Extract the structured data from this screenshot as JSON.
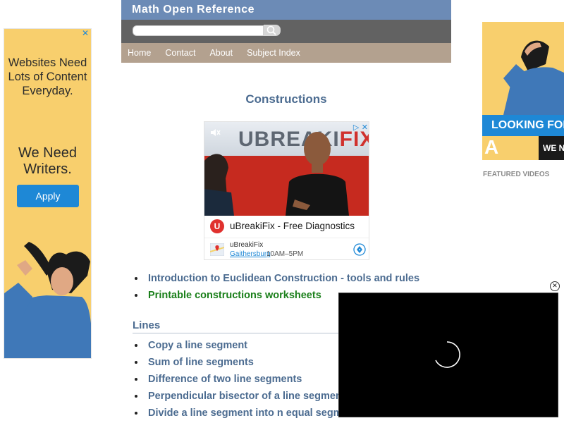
{
  "header": {
    "site_title": "Math Open Reference",
    "search": {
      "placeholder": "",
      "value": ""
    },
    "nav": [
      "Home",
      "Contact",
      "About",
      "Subject Index"
    ]
  },
  "main": {
    "page_title": "Constructions",
    "intro_links": [
      {
        "label": "Introduction to Euclidean Construction - tools and rules",
        "color": "#4b6b90"
      },
      {
        "label": "Printable constructions worksheets",
        "color": "#1a7f1a"
      }
    ],
    "sections": [
      {
        "heading": "Lines",
        "links": [
          "Copy a line segment",
          "Sum of line segments",
          "Difference of two line segments",
          "Perpendicular bisector of a line segment",
          "Divide a line segment into n equal segments"
        ]
      }
    ]
  },
  "ads": {
    "left": {
      "headline": "Websites Need Lots of Content Everyday.",
      "headline2": "We Need Writers.",
      "button": "Apply",
      "close": "✕"
    },
    "center": {
      "brand_left": "UBREAKI",
      "brand_right": "FIX",
      "badges": "▷ ✕",
      "logo_letter": "U",
      "headline": "uBreakiFix - Free Diagnostics",
      "location_name": "uBreakiFix",
      "location_city": "Gaithersburg",
      "location_hours": "10AM–5PM"
    },
    "right": {
      "band_text": "LOOKING FOR",
      "band2_text": "WE N",
      "big_letter": "A",
      "featured_label": "FEATURED VIDEOS"
    }
  },
  "player": {
    "close": "✕"
  },
  "colors": {
    "title_bar": "#6c8bb6",
    "search_bar": "#626262",
    "nav_bar": "#b3a18f",
    "link": "#4b6b90",
    "link_green": "#1a7f1a",
    "ad_yellow": "#f8cf6d",
    "ad_blue": "#1e88d6"
  }
}
